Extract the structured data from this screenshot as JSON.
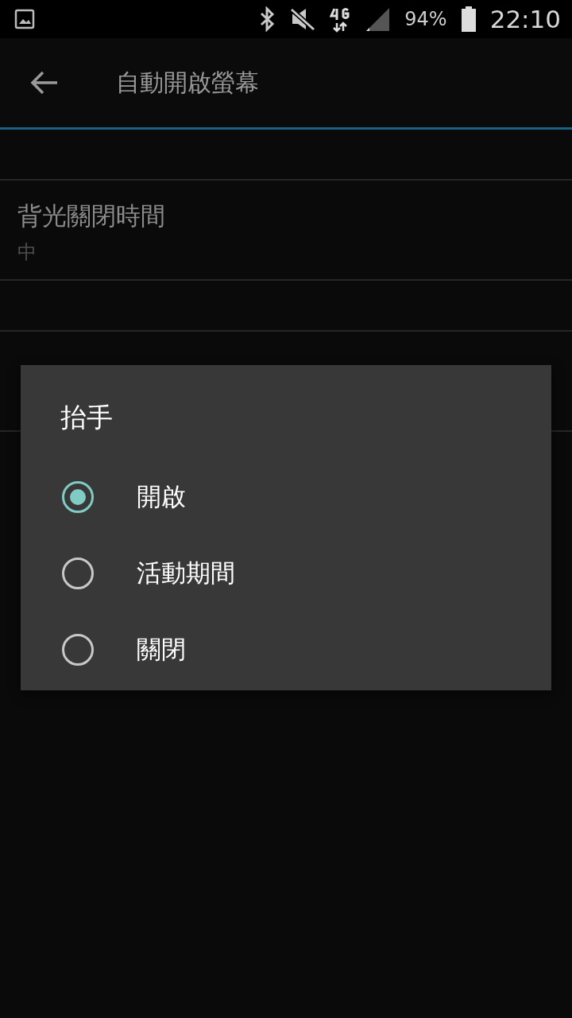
{
  "status_bar": {
    "battery": "94%",
    "time": "22:10"
  },
  "app_bar": {
    "title": "自動開啟螢幕"
  },
  "settings": [
    {
      "kind": "spacer"
    },
    {
      "kind": "item",
      "title": "背光關閉時間",
      "value": "中"
    },
    {
      "kind": "spacer"
    },
    {
      "kind": "item"
    }
  ],
  "dialog": {
    "title": "抬手",
    "options": [
      {
        "label": "開啟",
        "selected": true
      },
      {
        "label": "活動期間",
        "selected": false
      },
      {
        "label": "關閉",
        "selected": false
      }
    ]
  }
}
